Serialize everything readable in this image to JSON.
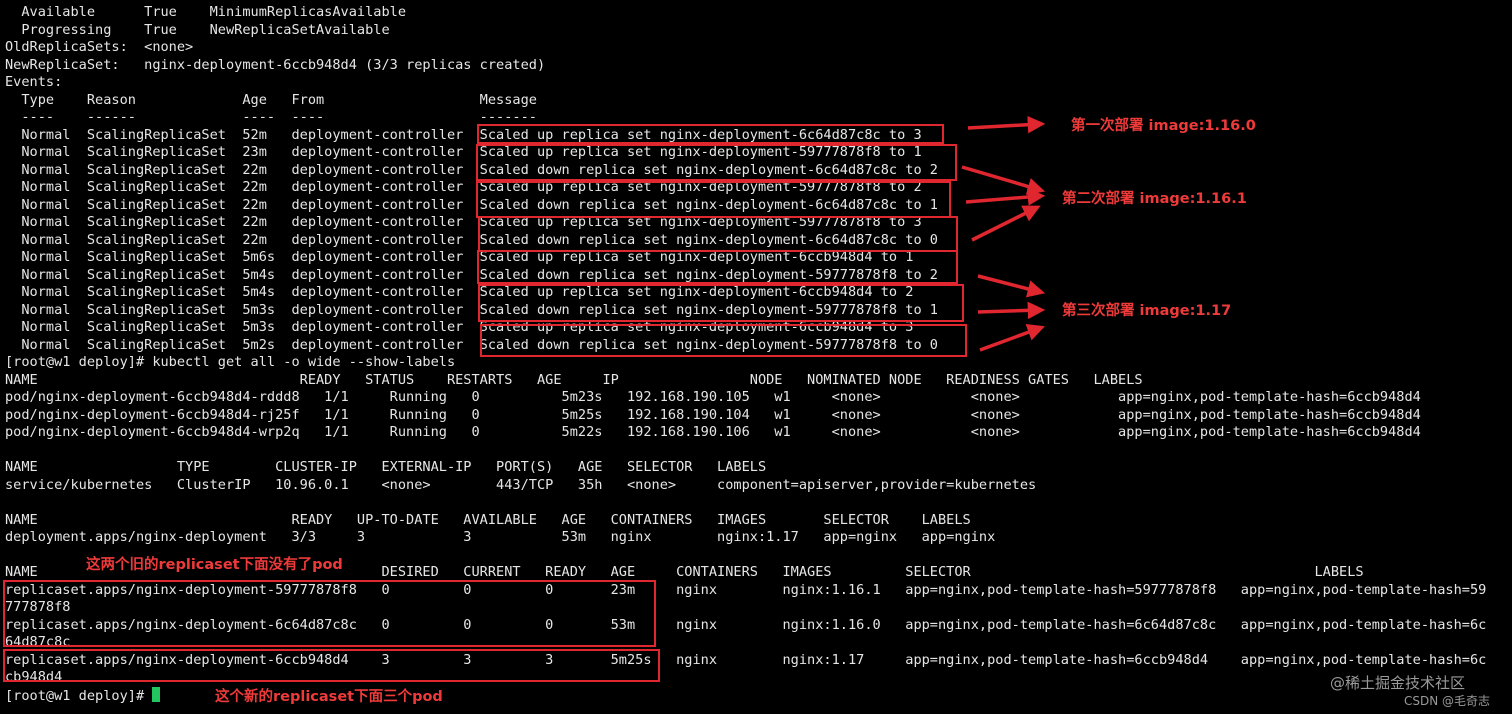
{
  "terminal": {
    "lines": [
      "  Available      True    MinimumReplicasAvailable",
      "  Progressing    True    NewReplicaSetAvailable",
      "OldReplicaSets:  <none>",
      "NewReplicaSet:   nginx-deployment-6ccb948d4 (3/3 replicas created)",
      "Events:",
      "  Type    Reason             Age   From                   Message",
      "  ----    ------             ----  ----                   -------",
      "  Normal  ScalingReplicaSet  52m   deployment-controller  Scaled up replica set nginx-deployment-6c64d87c8c to 3",
      "  Normal  ScalingReplicaSet  23m   deployment-controller  Scaled up replica set nginx-deployment-59777878f8 to 1",
      "  Normal  ScalingReplicaSet  22m   deployment-controller  Scaled down replica set nginx-deployment-6c64d87c8c to 2",
      "  Normal  ScalingReplicaSet  22m   deployment-controller  Scaled up replica set nginx-deployment-59777878f8 to 2",
      "  Normal  ScalingReplicaSet  22m   deployment-controller  Scaled down replica set nginx-deployment-6c64d87c8c to 1",
      "  Normal  ScalingReplicaSet  22m   deployment-controller  Scaled up replica set nginx-deployment-59777878f8 to 3",
      "  Normal  ScalingReplicaSet  22m   deployment-controller  Scaled down replica set nginx-deployment-6c64d87c8c to 0",
      "  Normal  ScalingReplicaSet  5m6s  deployment-controller  Scaled up replica set nginx-deployment-6ccb948d4 to 1",
      "  Normal  ScalingReplicaSet  5m4s  deployment-controller  Scaled down replica set nginx-deployment-59777878f8 to 2",
      "  Normal  ScalingReplicaSet  5m4s  deployment-controller  Scaled up replica set nginx-deployment-6ccb948d4 to 2",
      "  Normal  ScalingReplicaSet  5m3s  deployment-controller  Scaled down replica set nginx-deployment-59777878f8 to 1",
      "  Normal  ScalingReplicaSet  5m3s  deployment-controller  Scaled up replica set nginx-deployment-6ccb948d4 to 3",
      "  Normal  ScalingReplicaSet  5m2s  deployment-controller  Scaled down replica set nginx-deployment-59777878f8 to 0",
      "[root@w1 deploy]# kubectl get all -o wide --show-labels",
      "NAME                                READY   STATUS    RESTARTS   AGE     IP                NODE   NOMINATED NODE   READINESS GATES   LABELS",
      "pod/nginx-deployment-6ccb948d4-rddd8   1/1     Running   0          5m23s   192.168.190.105   w1     <none>           <none>            app=nginx,pod-template-hash=6ccb948d4",
      "pod/nginx-deployment-6ccb948d4-rj25f   1/1     Running   0          5m25s   192.168.190.104   w1     <none>           <none>            app=nginx,pod-template-hash=6ccb948d4",
      "pod/nginx-deployment-6ccb948d4-wrp2q   1/1     Running   0          5m22s   192.168.190.106   w1     <none>           <none>            app=nginx,pod-template-hash=6ccb948d4",
      "",
      "NAME                 TYPE        CLUSTER-IP   EXTERNAL-IP   PORT(S)   AGE   SELECTOR   LABELS",
      "service/kubernetes   ClusterIP   10.96.0.1    <none>        443/TCP   35h   <none>     component=apiserver,provider=kubernetes",
      "",
      "NAME                               READY   UP-TO-DATE   AVAILABLE   AGE   CONTAINERS   IMAGES       SELECTOR    LABELS",
      "deployment.apps/nginx-deployment   3/3     3            3           53m   nginx        nginx:1.17   app=nginx   app=nginx",
      "",
      "NAME                                          DESIRED   CURRENT   READY   AGE     CONTAINERS   IMAGES         SELECTOR                                          LABELS",
      "replicaset.apps/nginx-deployment-59777878f8   0         0         0       23m     nginx        nginx:1.16.1   app=nginx,pod-template-hash=59777878f8   app=nginx,pod-template-hash=59",
      "777878f8",
      "replicaset.apps/nginx-deployment-6c64d87c8c   0         0         0       53m     nginx        nginx:1.16.0   app=nginx,pod-template-hash=6c64d87c8c   app=nginx,pod-template-hash=6c",
      "64d87c8c",
      "replicaset.apps/nginx-deployment-6ccb948d4    3         3         3       5m25s   nginx        nginx:1.17     app=nginx,pod-template-hash=6ccb948d4    app=nginx,pod-template-hash=6c",
      "cb948d4"
    ],
    "prompt": "[root@w1 deploy]# "
  },
  "annotations": {
    "first_deploy": "第一次部署 image:1.16.0",
    "second_deploy": "第二次部署 image:1.16.1",
    "third_deploy": "第三次部署 image:1.17",
    "old_replicasets_note": "这两个旧的replicaset下面没有了pod",
    "new_replicaset_note": "这个新的replicaset下面三个pod"
  },
  "watermark": {
    "juejin": "@稀土掘金技术社区",
    "csdn": "CSDN @毛奇志"
  },
  "colors": {
    "background": "#000000",
    "text": "#e6e6e6",
    "annotation_red": "#e0262e",
    "cursor_green": "#22c55e"
  }
}
